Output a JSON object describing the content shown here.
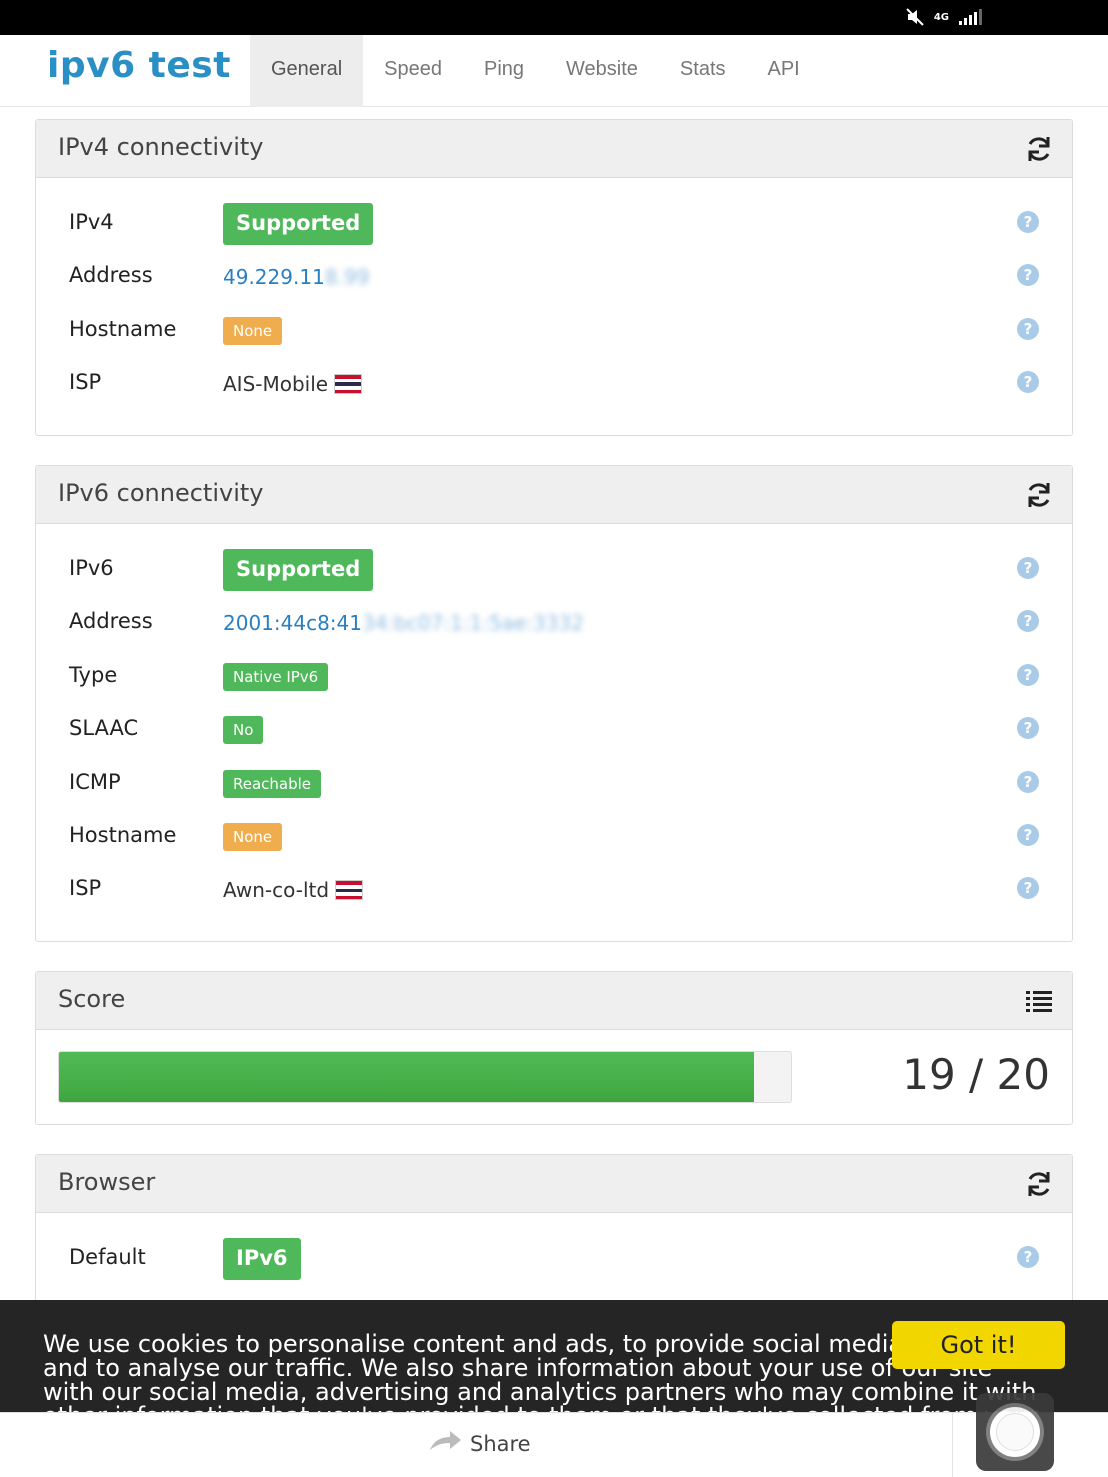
{
  "header": {
    "logo_part1": "ipv6",
    "logo_part2": "test",
    "tabs": [
      {
        "label": "General",
        "active": true
      },
      {
        "label": "Speed"
      },
      {
        "label": "Ping"
      },
      {
        "label": "Website"
      },
      {
        "label": "Stats"
      },
      {
        "label": "API"
      }
    ]
  },
  "status_bar": {
    "network": "4G",
    "icons": [
      "mute-icon",
      "network-4g-icon",
      "signal-icon"
    ]
  },
  "ipv4": {
    "title": "IPv4 connectivity",
    "rows": [
      {
        "label": "IPv4",
        "value": "Supported",
        "kind": "badge-lg"
      },
      {
        "label": "Address",
        "value": "49.229.11",
        "blurred": "8.99",
        "kind": "link"
      },
      {
        "label": "Hostname",
        "value": "None",
        "kind": "badge-warn"
      },
      {
        "label": "ISP",
        "value": "AIS-Mobile",
        "kind": "flag"
      }
    ]
  },
  "ipv6": {
    "title": "IPv6 connectivity",
    "rows": [
      {
        "label": "IPv6",
        "value": "Supported",
        "kind": "badge-lg"
      },
      {
        "label": "Address",
        "value": "2001:44c8:41",
        "blurred": "34:bc07:1:1:5ae:3332",
        "kind": "link"
      },
      {
        "label": "Type",
        "value": "Native IPv6",
        "kind": "badge-sm"
      },
      {
        "label": "SLAAC",
        "value": "No",
        "kind": "badge-sm"
      },
      {
        "label": "ICMP",
        "value": "Reachable",
        "kind": "badge-sm"
      },
      {
        "label": "Hostname",
        "value": "None",
        "kind": "badge-warn"
      },
      {
        "label": "ISP",
        "value": "Awn-co-ltd",
        "kind": "flag"
      }
    ]
  },
  "score": {
    "title": "Score",
    "value": 19,
    "max": 20,
    "text": "19 / 20",
    "fill_fraction": 0.95
  },
  "browser": {
    "title": "Browser",
    "rows": [
      {
        "label": "Default",
        "value": "IPv6",
        "kind": "badge-lg"
      }
    ]
  },
  "cookie": {
    "text": "We use cookies to personalise content and ads, to provide social media features and to analyse our traffic. We also share information about your use of our site with our social media, advertising and analytics partners who may combine it with other information that you've provided to them or that they've collected from your use of their services.",
    "button": "Got it!"
  },
  "bottom_bar": {
    "share_label": "Share"
  },
  "colors": {
    "accent_blue": "#2a8fc4",
    "accent_pink": "#e0337a",
    "success": "#4fb85a",
    "warning": "#f0ad4e",
    "cookie_button": "#f1d600"
  },
  "help_glyph": "?"
}
